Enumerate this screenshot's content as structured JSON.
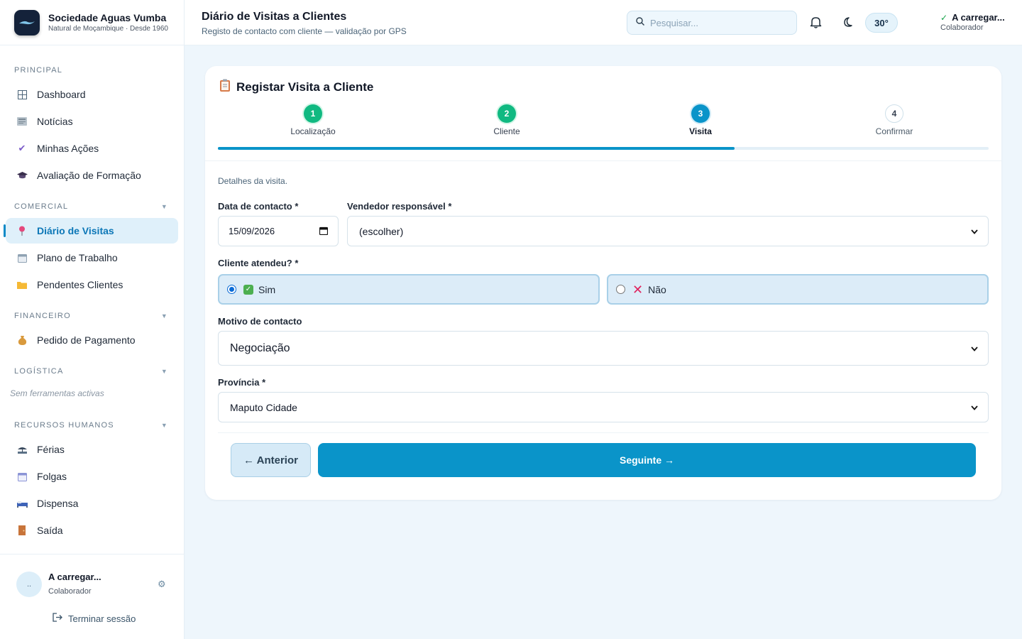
{
  "brand": {
    "name": "Sociedade Aguas Vumba",
    "tagline": "Natural de Moçambique · Desde 1960"
  },
  "sidebar": {
    "sections": [
      {
        "title": "PRINCIPAL",
        "items": [
          {
            "label": "Dashboard",
            "icon": "grid-icon"
          },
          {
            "label": "Notícias",
            "icon": "newspaper-icon"
          },
          {
            "label": "Minhas Ações",
            "icon": "checkmark-icon"
          },
          {
            "label": "Avaliação de Formação",
            "icon": "graduation-cap-icon"
          }
        ]
      },
      {
        "title": "COMERCIAL",
        "items": [
          {
            "label": "Diário de Visitas",
            "icon": "pin-icon",
            "active": true
          },
          {
            "label": "Plano de Trabalho",
            "icon": "calendar-icon"
          },
          {
            "label": "Pendentes Clientes",
            "icon": "folder-icon"
          }
        ]
      },
      {
        "title": "FINANCEIRO",
        "items": [
          {
            "label": "Pedido de Pagamento",
            "icon": "money-bag-icon"
          }
        ]
      },
      {
        "title": "LOGÍSTICA",
        "empty_text": "Sem ferramentas activas"
      },
      {
        "title": "RECURSOS HUMANOS",
        "items": [
          {
            "label": "Férias",
            "icon": "beach-icon"
          },
          {
            "label": "Folgas",
            "icon": "calendar-icon"
          },
          {
            "label": "Dispensa",
            "icon": "bed-icon"
          },
          {
            "label": "Saída",
            "icon": "door-icon"
          }
        ]
      }
    ],
    "user": {
      "avatar_text": "..",
      "name": "A carregar...",
      "role": "Colaborador"
    },
    "logout_label": "Terminar sessão"
  },
  "header": {
    "title": "Diário de Visitas a Clientes",
    "subtitle": "Registo de contacto com cliente — validação por GPS",
    "search_placeholder": "Pesquisar...",
    "temperature": "30°",
    "user_name": "A carregar...",
    "user_role": "Colaborador"
  },
  "form": {
    "title": "Registar Visita a Cliente",
    "steps": [
      {
        "number": "1",
        "label": "Localização",
        "state": "done"
      },
      {
        "number": "2",
        "label": "Cliente",
        "state": "done"
      },
      {
        "number": "3",
        "label": "Visita",
        "state": "current"
      },
      {
        "number": "4",
        "label": "Confirmar",
        "state": "pending"
      }
    ],
    "progress": 0.67,
    "hint": "Detalhes da visita.",
    "contact_date_label": "Data de contacto *",
    "contact_date_value": "15/09/2026",
    "seller_label": "Vendedor responsável *",
    "seller_value": "(escolher)",
    "client_attended_label": "Cliente atendeu? *",
    "attended_yes": "Sim",
    "attended_no": "Não",
    "attended_selected": "Sim",
    "reason_label": "Motivo de contacto",
    "reason_value": "Negociação",
    "province_label": "Província *",
    "province_value": "Maputo Cidade",
    "prev_button": "← Anterior",
    "next_button": "Seguinte →"
  },
  "colors": {
    "accent": "#0a94c9",
    "success": "#10b981",
    "active_bg": "#dff0fa"
  }
}
